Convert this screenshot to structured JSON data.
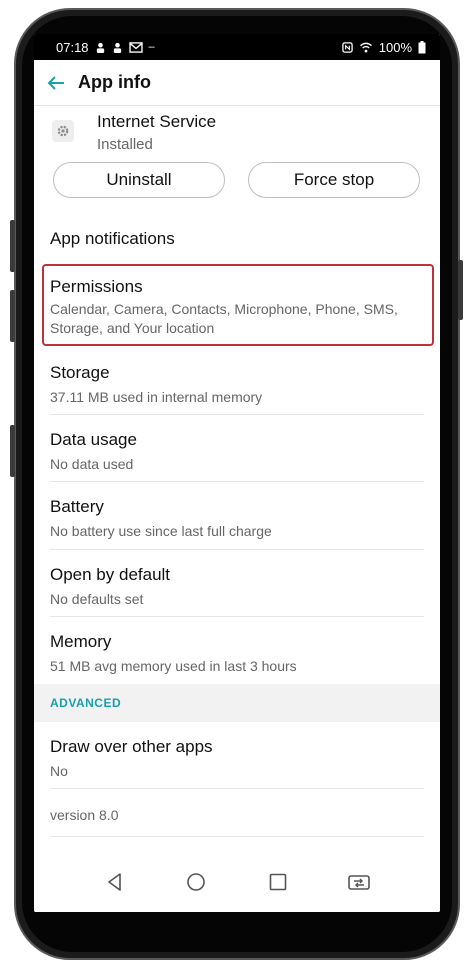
{
  "status_bar": {
    "time": "07:18",
    "battery": "100%"
  },
  "app_bar": {
    "title": "App info"
  },
  "app": {
    "name": "Internet Service",
    "state": "Installed"
  },
  "buttons": {
    "uninstall": "Uninstall",
    "force_stop": "Force stop"
  },
  "rows": {
    "notifications": {
      "title": "App notifications"
    },
    "permissions": {
      "title": "Permissions",
      "sub": "Calendar, Camera, Contacts, Microphone, Phone, SMS, Storage, and Your location"
    },
    "storage": {
      "title": "Storage",
      "sub": "37.11 MB used in internal memory"
    },
    "data_usage": {
      "title": "Data usage",
      "sub": "No data used"
    },
    "battery": {
      "title": "Battery",
      "sub": "No battery use since last full charge"
    },
    "open_by_default": {
      "title": "Open by default",
      "sub": "No defaults set"
    },
    "memory": {
      "title": "Memory",
      "sub": "51 MB avg memory used in last 3 hours"
    }
  },
  "advanced": {
    "header": "ADVANCED",
    "draw_over": {
      "title": "Draw over other apps",
      "sub": "No"
    },
    "version": "version 8.0"
  },
  "colors": {
    "accent": "#1aa0ad",
    "highlight": "#c0323a"
  },
  "icons": [
    "back-arrow-icon",
    "gear-icon",
    "nav-back-icon",
    "nav-home-icon",
    "nav-recents-icon",
    "nav-switch-icon"
  ]
}
